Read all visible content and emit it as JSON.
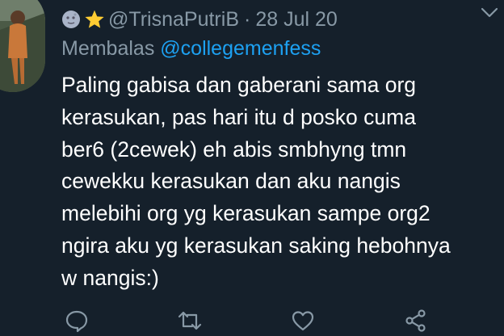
{
  "tweet": {
    "author_handle": "@TrisnaPutriB",
    "separator": "·",
    "date": "28 Jul 20",
    "name_emojis": [
      "moon-face-emoji",
      "star-emoji"
    ],
    "reply_prefix": "Membalas",
    "reply_to": "@collegemenfess",
    "text_lines": [
      "Paling gabisa dan gaberani sama org",
      "kerasukan, pas hari itu d posko cuma",
      "ber6 (2cewek) eh abis smbhyng tmn",
      "cewekku kerasukan dan aku nangis",
      "melebihi org yg kerasukan sampe org2",
      "ngira aku yg kerasukan saking hebohnya",
      "w nangis:)"
    ]
  },
  "icons": {
    "caret": "chevron-down-icon",
    "reply": "comment-icon",
    "retweet": "retweet-icon",
    "like": "heart-icon",
    "share": "share-icon"
  },
  "colors": {
    "background": "#15202b",
    "secondary_text": "#8899a6",
    "mention": "#1da1f2",
    "text": "#ffffff"
  }
}
